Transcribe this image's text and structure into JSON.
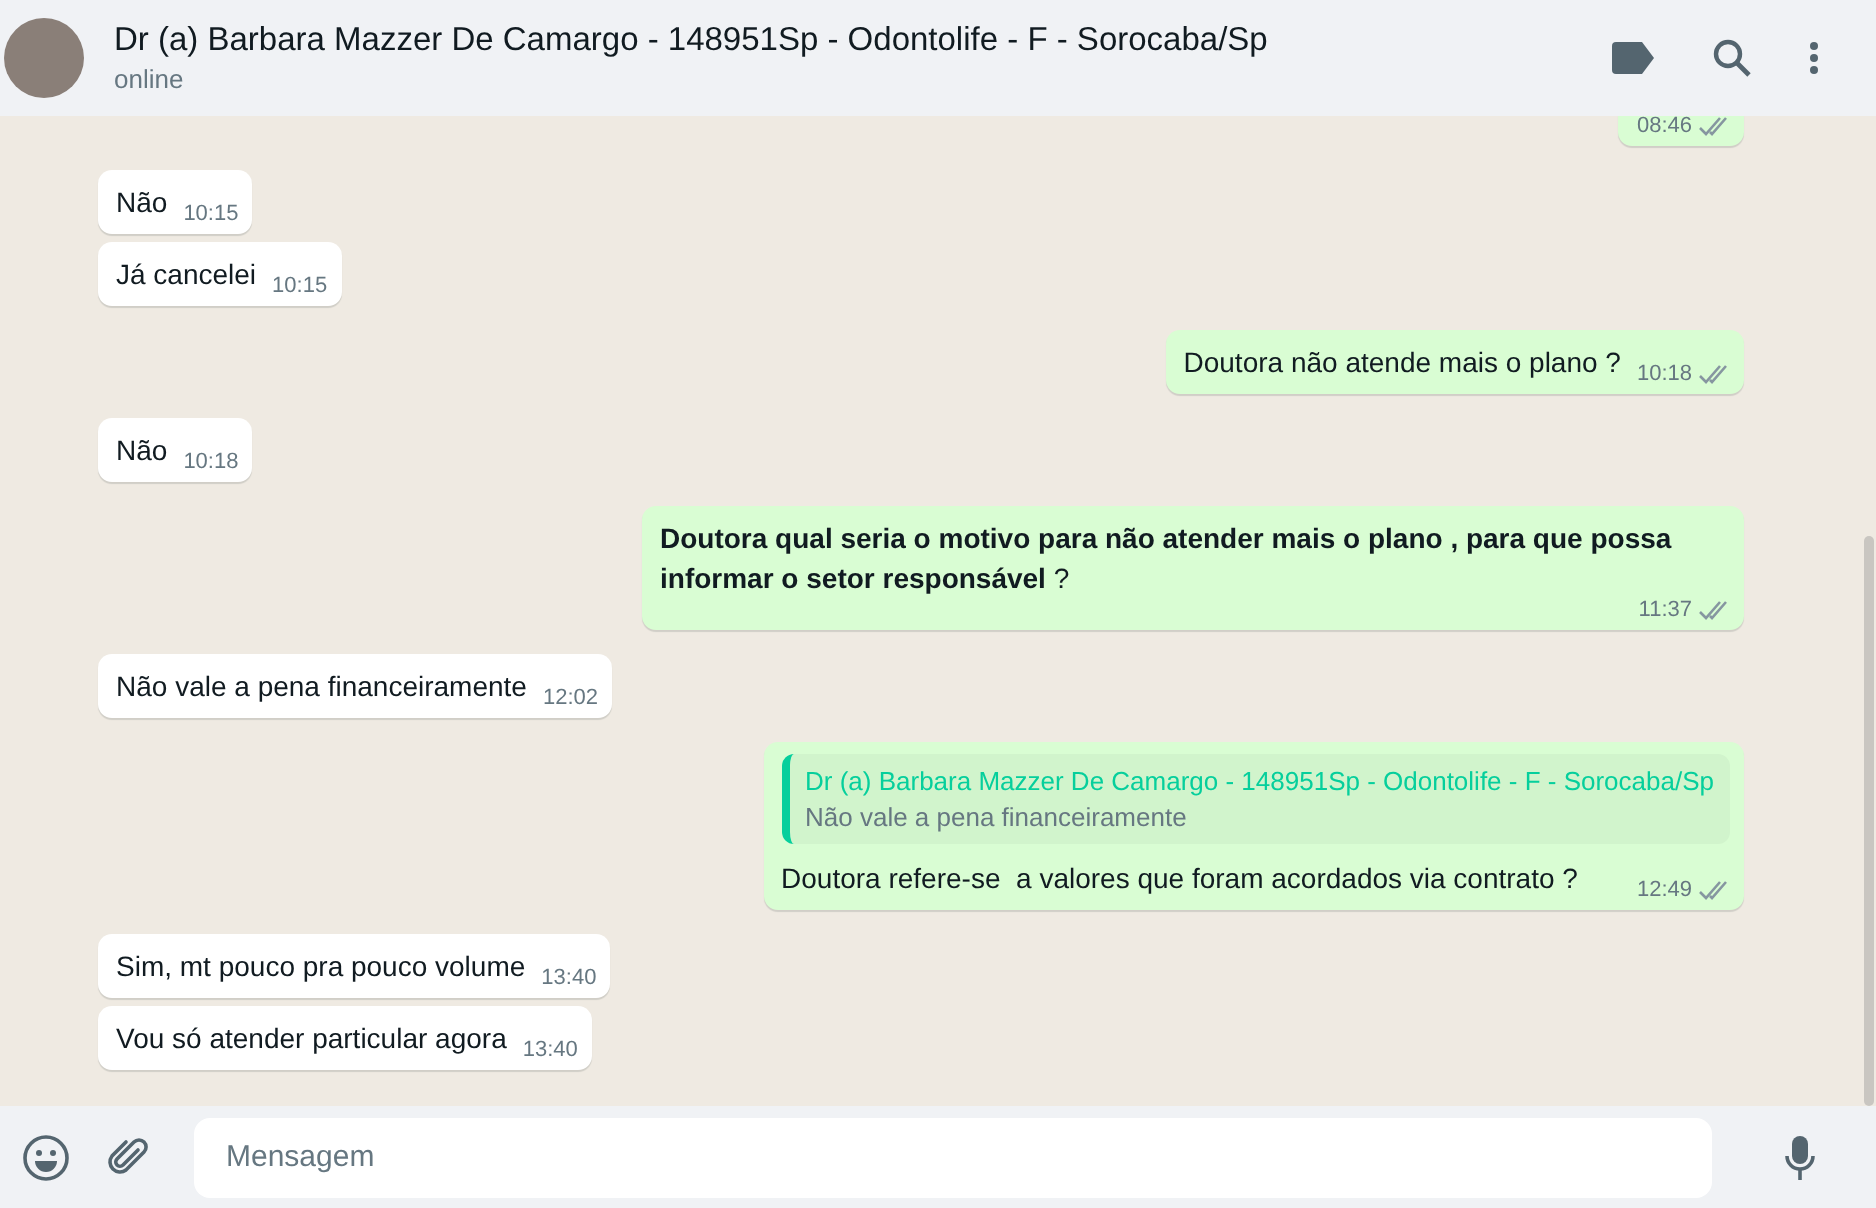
{
  "header": {
    "name": "Dr (a) Barbara Mazzer De Camargo - 148951Sp - Odontolife - F - Sorocaba/Sp",
    "status": "online"
  },
  "messages": [
    {
      "kind": "out",
      "time": "08:46"
    },
    {
      "kind": "in",
      "text": "Não",
      "time": "10:15"
    },
    {
      "kind": "in",
      "text": "Já cancelei",
      "time": "10:15"
    },
    {
      "kind": "out",
      "text": "Doutora não atende mais o plano ?",
      "time": "10:18"
    },
    {
      "kind": "in",
      "text": "Não",
      "time": "10:18"
    },
    {
      "kind": "out",
      "text": "**Doutora qual seria o motivo para não atender mais o plano , para que possa informar o setor responsável** ?",
      "time": "11:37"
    },
    {
      "kind": "in",
      "text": "Não vale a pena financeiramente",
      "time": "12:02"
    },
    {
      "kind": "out",
      "text": "Doutora refere-se  a valores que foram acordados via contrato ?",
      "time": "12:49",
      "quote": {
        "author": "Dr (a) Barbara Mazzer De Camargo - 148951Sp - Odontolife - F - Sorocaba/Sp",
        "text": "Não vale a pena financeiramente"
      }
    },
    {
      "kind": "in",
      "text": "Sim, mt pouco pra pouco volume",
      "time": "13:40"
    },
    {
      "kind": "in",
      "text": "Vou só atender particular agora",
      "time": "13:40"
    }
  ],
  "composer": {
    "placeholder": "Mensagem"
  }
}
